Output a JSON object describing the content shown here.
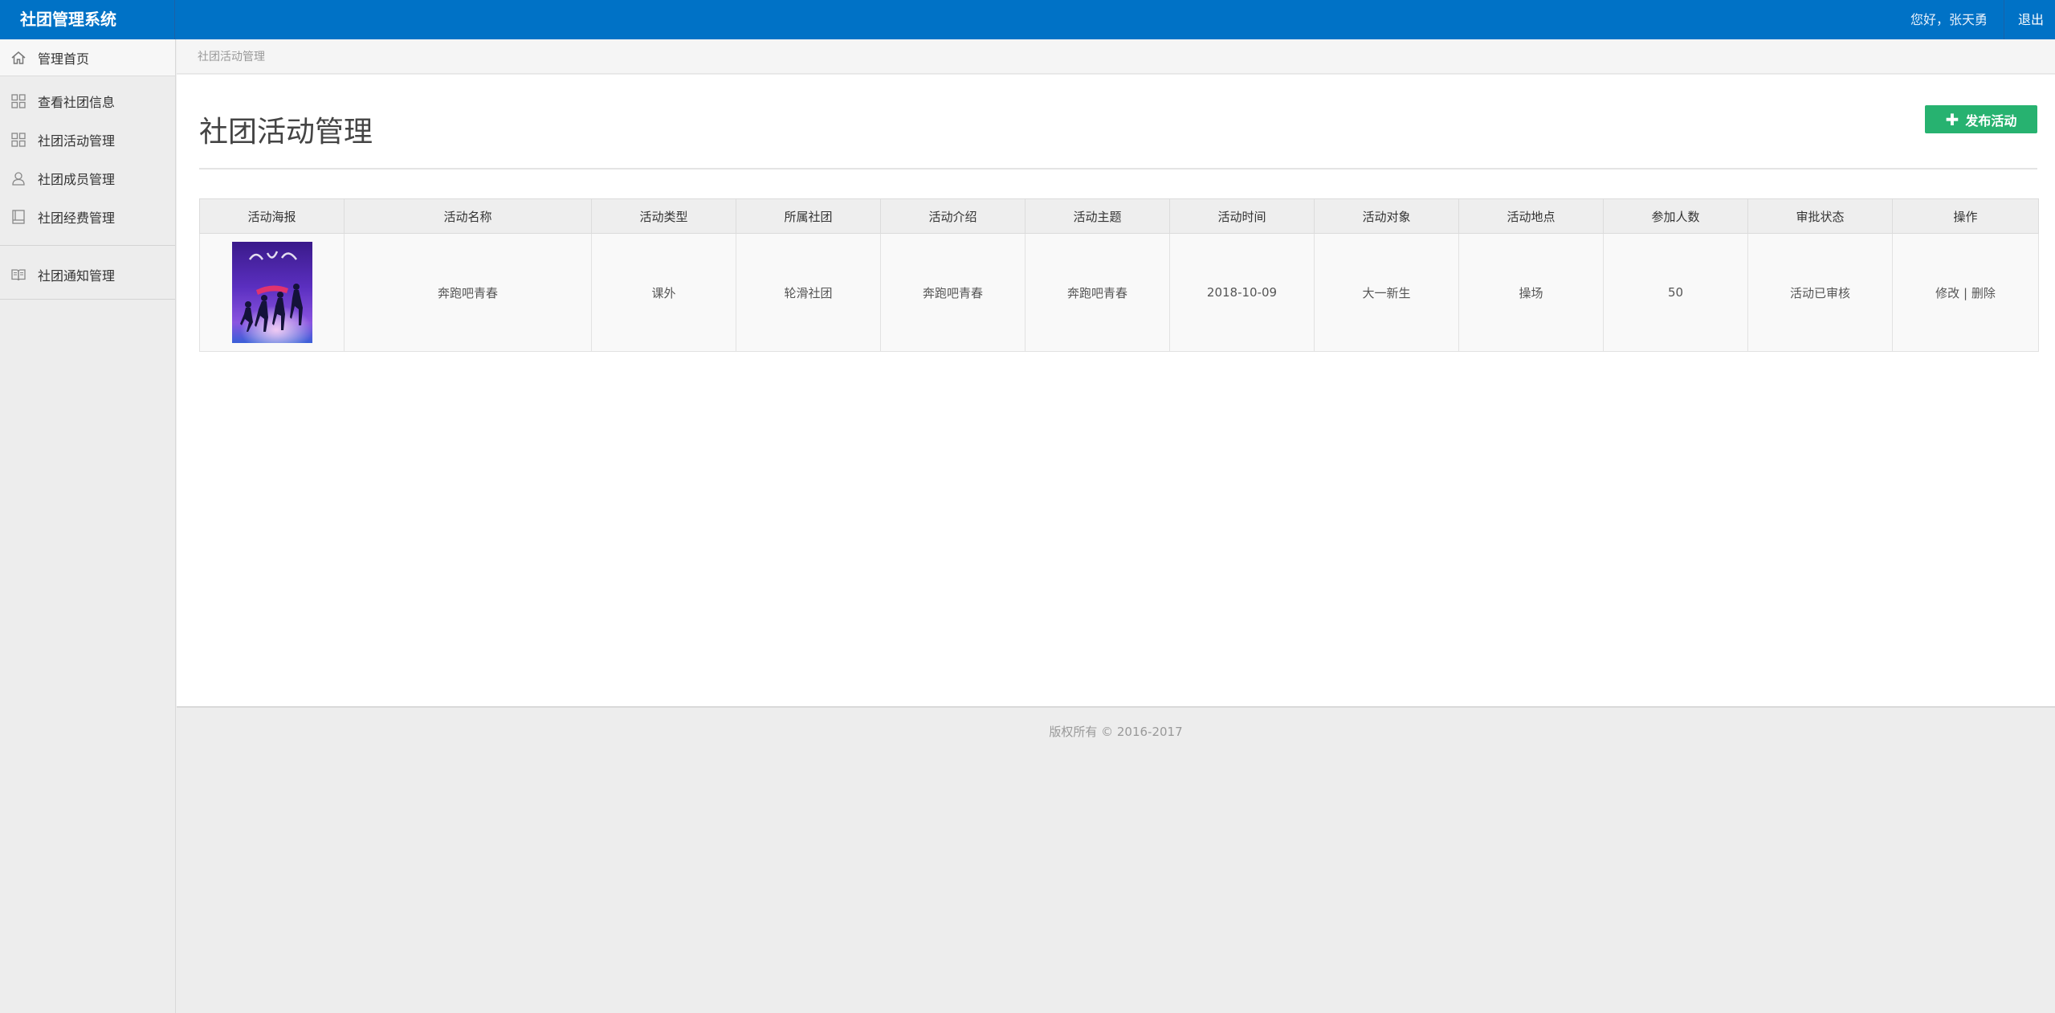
{
  "app": {
    "title": "社团管理系统",
    "greeting": "您好，张天勇",
    "logout": "退出"
  },
  "sidebar": {
    "items": [
      {
        "label": "管理首页",
        "icon": "home-icon"
      },
      {
        "label": "查看社团信息",
        "icon": "grid-icon"
      },
      {
        "label": "社团活动管理",
        "icon": "grid-icon"
      },
      {
        "label": "社团成员管理",
        "icon": "user-icon"
      },
      {
        "label": "社团经费管理",
        "icon": "book-icon"
      },
      {
        "label": "社团通知管理",
        "icon": "open-book-icon"
      }
    ]
  },
  "breadcrumb": "社团活动管理",
  "page": {
    "title": "社团活动管理",
    "add_button": "发布活动"
  },
  "table": {
    "headers": [
      "活动海报",
      "活动名称",
      "活动类型",
      "所属社团",
      "活动介绍",
      "活动主题",
      "活动时间",
      "活动对象",
      "活动地点",
      "参加人数",
      "审批状态",
      "操作"
    ],
    "rows": [
      {
        "poster_alt": "奔跑吧青春海报",
        "name": "奔跑吧青春",
        "type": "课外",
        "club": "轮滑社团",
        "intro": "奔跑吧青春",
        "theme": "奔跑吧青春",
        "time": "2018-10-09",
        "target": "大一新生",
        "place": "操场",
        "count": "50",
        "status": "活动已审核",
        "edit": "修改",
        "sep": "|",
        "delete": "删除"
      }
    ]
  },
  "footer": "版权所有 © 2016-2017",
  "colors": {
    "topbar": "#0072c6",
    "add_button": "#27b270"
  }
}
